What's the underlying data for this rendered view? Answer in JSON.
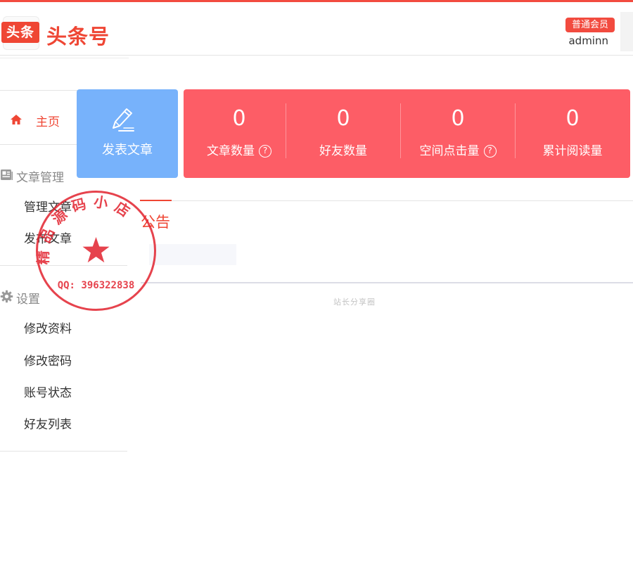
{
  "header": {
    "logo_badge": "头条",
    "logo_text": "头条号",
    "member_badge": "普通会员",
    "username": "adminn"
  },
  "sidebar": {
    "home_label": "主页",
    "groups": [
      {
        "title": "文章管理",
        "icon": "article-icon",
        "items": [
          "管理文章",
          "发布文章"
        ]
      },
      {
        "title": "设置",
        "icon": "gear-icon",
        "items": [
          "修改资料",
          "修改密码",
          "账号状态",
          "好友列表"
        ]
      }
    ]
  },
  "post_card": {
    "label": "发表文章",
    "icon": "pen-icon"
  },
  "stats": [
    {
      "value": "0",
      "label": "文章数量",
      "help": true
    },
    {
      "value": "0",
      "label": "好友数量",
      "help": false
    },
    {
      "value": "0",
      "label": "空间点击量",
      "help": true
    },
    {
      "value": "0",
      "label": "累计阅读量",
      "help": false
    }
  ],
  "help_symbol": "?",
  "notice": {
    "title": "公告"
  },
  "watermark_text": "站长分享圈",
  "stamp": {
    "text": "精品源码小店",
    "qq": "QQ: 396322838"
  },
  "colors": {
    "brand_red": "#ef4634",
    "post_card_blue": "#77b2fb",
    "stats_card_red": "#fd5d66",
    "stamp_red": "#e2232f"
  }
}
